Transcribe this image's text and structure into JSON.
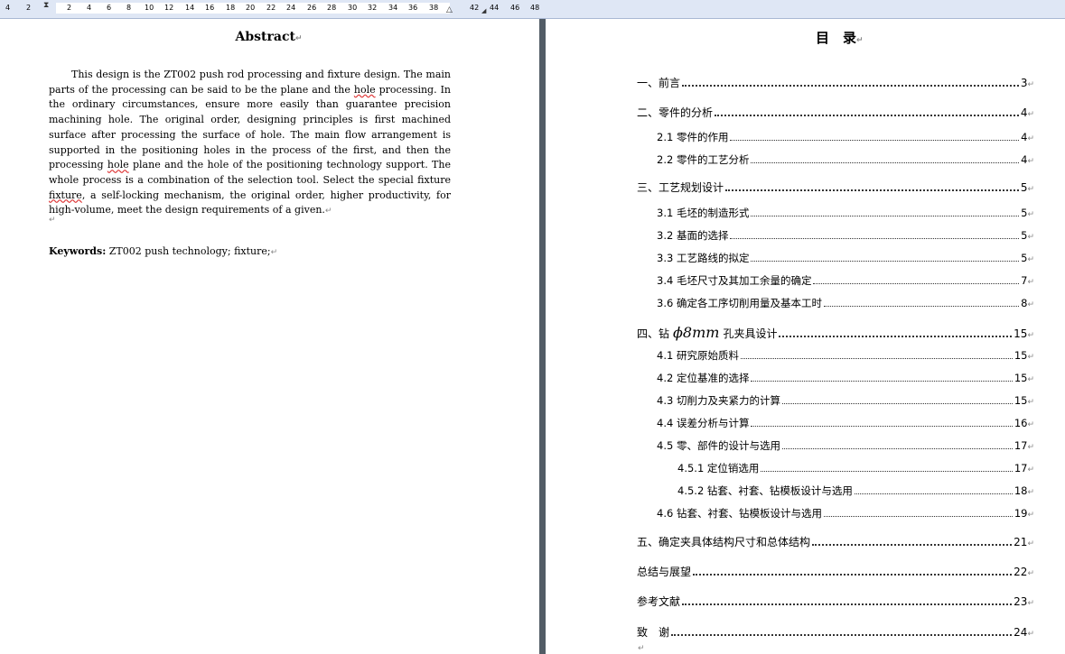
{
  "ruler": {
    "left_numbers": [
      "4",
      "2"
    ],
    "numbers": [
      "2",
      "4",
      "6",
      "8",
      "10",
      "12",
      "14",
      "16",
      "18",
      "20",
      "22",
      "24",
      "26",
      "28",
      "30",
      "32",
      "34",
      "36",
      "38"
    ],
    "right_numbers": [
      "42",
      "44",
      "46",
      "48"
    ]
  },
  "abstract": {
    "title": "Abstract",
    "body_parts": [
      "This design is the ZT002 push rod processing and fixture design. The main parts of the processing can be said to be the plane and the ",
      "hole",
      " processing. In the ordinary circumstances, ensure more easily than guarantee precision machining hole. The original order, designing principles is first machined surface after processing the surface of hole. The main flow arrangement is supported in the positioning holes in the process of the first, and then the processing ",
      "hole",
      " plane and the hole of the positioning technology support. The whole process is a combination of the selection tool. Select the special fixture ",
      "fixture",
      ", a self-locking mechanism, the original order, higher productivity, for high-volume, meet the design requirements of a given."
    ],
    "keywords_label": "Keywords:",
    "keywords_value": " ZT002 push technology; fixture;"
  },
  "toc": {
    "title": "目　录",
    "entries": [
      {
        "level": 1,
        "label": "一、前言",
        "page": "3"
      },
      {
        "level": 1,
        "label": "二、零件的分析",
        "page": "4"
      },
      {
        "level": 2,
        "label": "2.1 零件的作用",
        "page": "4"
      },
      {
        "level": 2,
        "label": "2.2 零件的工艺分析",
        "page": "4"
      },
      {
        "level": 1,
        "label": "三、工艺规划设计",
        "page": "5"
      },
      {
        "level": 2,
        "label": "3.1 毛坯的制造形式",
        "page": "5"
      },
      {
        "level": 2,
        "label": "3.2 基面的选择",
        "page": "5"
      },
      {
        "level": 2,
        "label": "3.3 工艺路线的拟定",
        "page": "5"
      },
      {
        "level": 2,
        "label": "3.4 毛坯尺寸及其加工余量的确定",
        "page": "7"
      },
      {
        "level": 2,
        "label": "3.6 确定各工序切削用量及基本工时",
        "page": "8"
      },
      {
        "level": 1,
        "label_prefix": "四、钻",
        "label_formula": "ϕ8mm",
        "label_suffix": "孔夹具设计",
        "page": "15"
      },
      {
        "level": 2,
        "label": "4.1 研究原始质料",
        "page": "15"
      },
      {
        "level": 2,
        "label": "4.2 定位基准的选择",
        "page": "15"
      },
      {
        "level": 2,
        "label": "4.3 切削力及夹紧力的计算",
        "page": "15"
      },
      {
        "level": 2,
        "label": "4.4 误差分析与计算",
        "page": "16"
      },
      {
        "level": 2,
        "label": "4.5 零、部件的设计与选用",
        "page": "17"
      },
      {
        "level": 3,
        "label": "4.5.1 定位销选用",
        "page": "17"
      },
      {
        "level": 3,
        "label": "4.5.2 钻套、衬套、钻模板设计与选用",
        "page": "18"
      },
      {
        "level": 2,
        "label": "4.6 钻套、衬套、钻模板设计与选用",
        "page": "19"
      },
      {
        "level": 1,
        "label": "五、确定夹具体结构尺寸和总体结构",
        "page": "21"
      },
      {
        "level": 1,
        "label": "总结与展望",
        "page": "22"
      },
      {
        "level": 1,
        "label": "参考文献",
        "page": "23"
      },
      {
        "level": 1,
        "label": "致　谢",
        "page": "24"
      }
    ]
  }
}
